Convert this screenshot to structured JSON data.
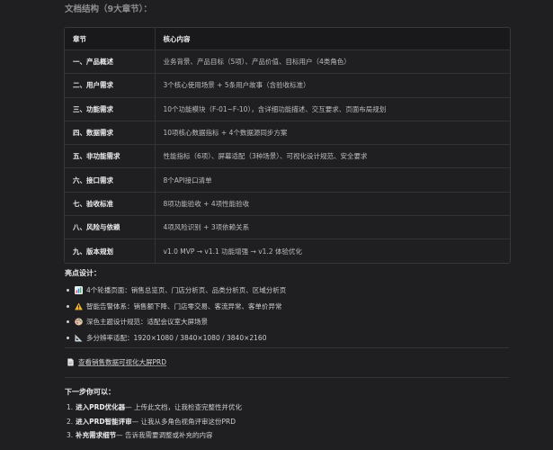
{
  "section_title_partial": "文档结构（9大章节）：",
  "table": {
    "headers": [
      "章节",
      "核心内容"
    ],
    "rows": [
      {
        "chapter": "一、产品概述",
        "content": "业务背景、产品目标（5项）、产品价值、目标用户（4类角色）"
      },
      {
        "chapter": "二、用户需求",
        "content": "3个核心使用场景 + 5条用户故事（含验收标准）"
      },
      {
        "chapter": "三、功能需求",
        "content": "10个功能模块（F-01~F-10），含详细功能描述、交互要求、页面布局规划"
      },
      {
        "chapter": "四、数据需求",
        "content": "10项核心数据指标 + 4个数据源同步方案"
      },
      {
        "chapter": "五、非功能需求",
        "content": "性能指标（6项）、屏幕适配（3种场景）、可视化设计规范、安全要求"
      },
      {
        "chapter": "六、接口需求",
        "content": "8个API接口清单"
      },
      {
        "chapter": "七、验收标准",
        "content": "8项功能验收 + 4项性能验收"
      },
      {
        "chapter": "八、风险与依赖",
        "content": "4项风险识别 + 3项依赖关系"
      },
      {
        "chapter": "九、版本规划",
        "content": "v1.0 MVP → v1.1 功能增强 → v1.2 体验优化"
      }
    ]
  },
  "highlights": {
    "title": "亮点设计：",
    "items": [
      {
        "icon": "bar-chart-icon",
        "prefix": "4个轮播页面：",
        "text": "销售总览页、门店分析页、品类分析页、区域分析页"
      },
      {
        "icon": "warning-icon",
        "prefix": "智能告警体系：",
        "text": "销售额下降、门店零交易、客流异常、客单价异常"
      },
      {
        "icon": "palette-icon",
        "prefix": "深色主题设计规范：",
        "text": "适配会议室大屏场景"
      },
      {
        "icon": "ruler-icon",
        "prefix": "多分辨率适配：",
        "text": "1920×1080 / 3840×1080 / 3840×2160"
      }
    ]
  },
  "doc_link": {
    "icon": "document-icon",
    "label": "查看销售数据可视化大屏PRD"
  },
  "next_steps": {
    "title": "下一步你可以：",
    "items": [
      {
        "num": "1.",
        "action": "进入PRD优化器",
        "desc": " — 上传此文档，让我检查完整性并优化"
      },
      {
        "num": "2.",
        "action": "进入PRD智能评审",
        "desc": " — 让我从多角色视角评审这份PRD"
      },
      {
        "num": "3.",
        "action": "补充需求细节",
        "desc": " — 告诉我需要调整或补充的内容"
      }
    ]
  }
}
